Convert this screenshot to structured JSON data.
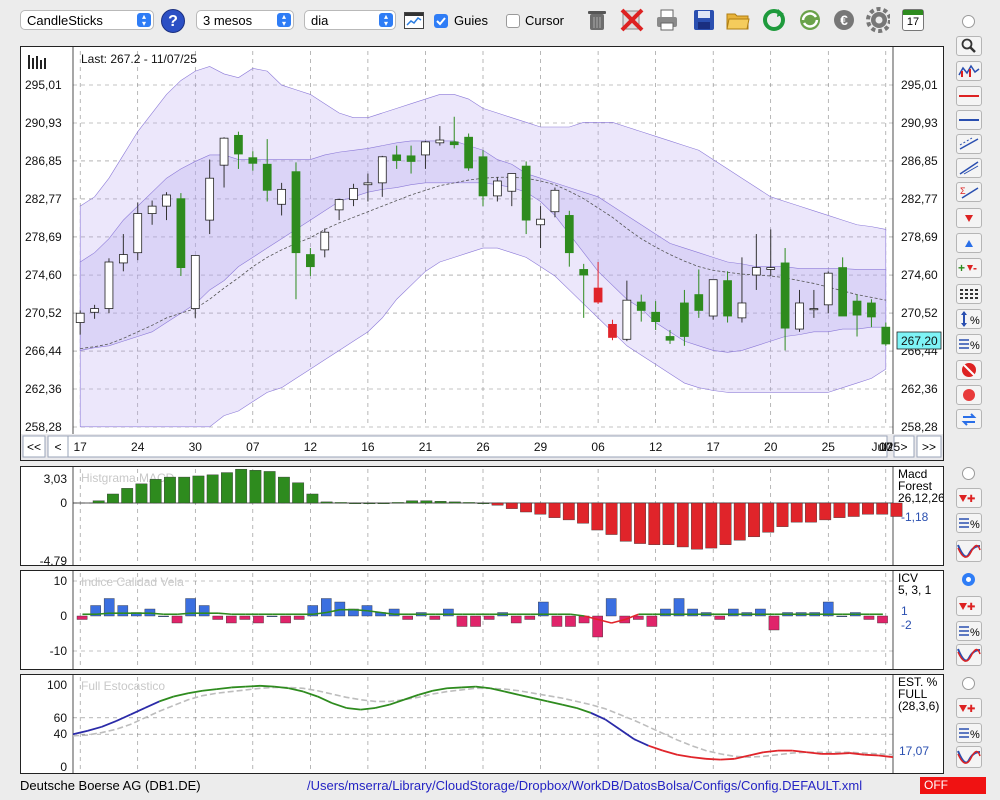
{
  "toolbar": {
    "chart_type": "CandleSticks",
    "period": "3 mesos",
    "interval": "dia",
    "guides_label": "Guies",
    "guides_checked": true,
    "cursor_label": "Cursor",
    "cursor_checked": false,
    "calendar_day": "17",
    "icons": [
      "help-icon",
      "chart-style-icon",
      "trash-icon",
      "delete-icon",
      "print-icon",
      "save-icon",
      "open-folder-icon",
      "refresh-icon",
      "sync-icon",
      "euro-icon",
      "settings-icon",
      "calendar-icon"
    ]
  },
  "main_chart": {
    "last_label": "Last: 267.2 - 11/07/25",
    "price_ticks": [
      "295,01",
      "290,93",
      "286,85",
      "282,77",
      "278,69",
      "274,60",
      "270,52",
      "266,44",
      "262,36",
      "258,28"
    ],
    "current_price_tag": "267,20",
    "nav": {
      "first": "<<",
      "prev": "<",
      "next": ">",
      "last": ">>"
    },
    "date_ticks": [
      "17",
      "24",
      "30",
      "07",
      "12",
      "16",
      "21",
      "26",
      "29",
      "06",
      "12",
      "17",
      "20",
      "25",
      "Jul25",
      "07",
      "10"
    ]
  },
  "macd": {
    "title": "Histgrama MACD",
    "ticks": [
      "3,03",
      "0",
      "-4,79"
    ],
    "legend": [
      "Macd",
      "Forest",
      "26,12,26"
    ],
    "value": "-1,18"
  },
  "icv": {
    "title": "Indice Calidad Vela",
    "ticks": [
      "10",
      "0",
      "-10"
    ],
    "legend": [
      "ICV",
      "5, 3, 1"
    ],
    "value1": "1",
    "value2": "-2"
  },
  "stochastic": {
    "title": "Full Estocastico",
    "ticks": [
      "100",
      "60",
      "40",
      "0"
    ],
    "legend": [
      "EST. %",
      "FULL",
      "(28,3,6)"
    ],
    "value": "17,07"
  },
  "status": {
    "ticker": "Deutsche Boerse AG (DB1.DE)",
    "path": "/Users/mserra/Library/CloudStorage/Dropbox/WorkDB/DatosBolsa/Configs/Config.DEFAULT.xml",
    "badge": "OFF"
  },
  "colors": {
    "up": "#2e8b1e",
    "down": "#e0242a",
    "band": "#b9aaf0",
    "macd_pos": "#2e8b1e",
    "macd_neg": "#e0242a",
    "icv_pos": "#3b6fe0",
    "icv_neg": "#e0246a",
    "accent": "#2f7df6"
  },
  "chart_data": [
    {
      "type": "candlestick",
      "ylim": [
        258.28,
        297.0
      ],
      "x": [
        "17",
        "",
        "",
        "",
        "24",
        "",
        "",
        "",
        "",
        "30",
        "",
        "",
        "",
        "07",
        "",
        "",
        "",
        "12",
        "",
        "",
        "",
        "16",
        "",
        "",
        "",
        "21",
        "",
        "",
        "",
        "26",
        "",
        "",
        "",
        "29",
        "",
        "",
        "",
        "",
        "06",
        "",
        "",
        "",
        "12",
        "",
        "",
        "",
        "17",
        "",
        "",
        "",
        "20",
        "",
        "",
        "",
        "25",
        "",
        "",
        "",
        "Jul25",
        "",
        "",
        "",
        "07",
        "",
        "",
        "",
        "10",
        ""
      ],
      "candles": [
        [
          269.5,
          270.8,
          268.2,
          270.5
        ],
        [
          270.6,
          271.4,
          269.9,
          271.0
        ],
        [
          271.0,
          276.4,
          270.5,
          276.0
        ],
        [
          275.9,
          279.0,
          275.0,
          276.8
        ],
        [
          277.0,
          282.4,
          276.2,
          281.2
        ],
        [
          281.2,
          282.6,
          280.0,
          282.0
        ],
        [
          282.0,
          283.5,
          280.5,
          283.2
        ],
        [
          282.8,
          283.4,
          274.5,
          275.4
        ],
        [
          271.0,
          276.7,
          270.0,
          276.7
        ],
        [
          280.5,
          287.0,
          279.0,
          285.0
        ],
        [
          286.4,
          289.4,
          284.0,
          289.3
        ],
        [
          289.6,
          290.0,
          286.0,
          287.6
        ],
        [
          287.2,
          287.9,
          285.8,
          286.6
        ],
        [
          286.5,
          289.2,
          282.5,
          283.7
        ],
        [
          282.2,
          284.5,
          281.0,
          283.8
        ],
        [
          285.7,
          286.7,
          272.0,
          277.0
        ],
        [
          276.8,
          277.5,
          274.5,
          275.5
        ],
        [
          277.3,
          279.6,
          276.5,
          279.2
        ],
        [
          281.6,
          282.8,
          280.5,
          282.7
        ],
        [
          282.7,
          284.4,
          282.0,
          283.9
        ],
        [
          284.3,
          285.5,
          282.5,
          284.5
        ],
        [
          284.5,
          287.4,
          283.0,
          287.3
        ],
        [
          287.5,
          288.5,
          286.0,
          286.9
        ],
        [
          287.4,
          288.5,
          285.5,
          286.8
        ],
        [
          287.5,
          289.0,
          286.0,
          288.9
        ],
        [
          288.8,
          290.6,
          288.5,
          289.1
        ],
        [
          288.9,
          291.6,
          288.2,
          288.6
        ],
        [
          289.4,
          289.8,
          285.8,
          286.1
        ],
        [
          287.3,
          288.0,
          282.0,
          283.1
        ],
        [
          283.1,
          285.1,
          282.5,
          284.7
        ],
        [
          283.6,
          285.5,
          282.0,
          285.5
        ],
        [
          286.3,
          286.8,
          279.0,
          280.5
        ],
        [
          280.0,
          282.0,
          277.5,
          280.6
        ],
        [
          281.4,
          284.0,
          280.8,
          283.7
        ],
        [
          281.0,
          281.5,
          275.5,
          277.0
        ],
        [
          275.2,
          275.8,
          270.0,
          274.6
        ],
        [
          273.2,
          276.0,
          271.5,
          271.7
        ],
        [
          269.3,
          269.8,
          267.6,
          267.9
        ],
        [
          267.7,
          274.0,
          267.5,
          271.9
        ],
        [
          271.7,
          272.5,
          269.6,
          270.8
        ],
        [
          270.6,
          271.8,
          268.7,
          269.6
        ],
        [
          268.0,
          268.7,
          267.2,
          267.6
        ],
        [
          271.6,
          273.0,
          267.0,
          268.0
        ],
        [
          272.5,
          275.2,
          270.0,
          270.8
        ],
        [
          270.2,
          274.0,
          269.8,
          274.1
        ],
        [
          274.0,
          275.0,
          269.5,
          270.2
        ],
        [
          270.0,
          276.5,
          269.5,
          271.6
        ],
        [
          274.6,
          279.0,
          273.0,
          275.4
        ],
        [
          275.2,
          279.5,
          274.5,
          275.4
        ],
        [
          275.9,
          277.5,
          266.5,
          268.9
        ],
        [
          268.8,
          273.0,
          268.5,
          271.6
        ],
        [
          270.9,
          273.0,
          270.0,
          271.0
        ],
        [
          271.4,
          275.0,
          270.5,
          274.8
        ],
        [
          275.4,
          276.5,
          270.2,
          270.2
        ],
        [
          271.8,
          272.5,
          268.0,
          270.3
        ],
        [
          271.6,
          272.0,
          269.0,
          270.1
        ],
        [
          269.0,
          269.5,
          267.0,
          267.2
        ]
      ],
      "sma": [
        266.7,
        266.9,
        267.2,
        267.8,
        268.5,
        269.2,
        270.0,
        270.5,
        271.0,
        272.0,
        273.2,
        274.3,
        275.5,
        276.5,
        277.3,
        278.0,
        278.6,
        279.5,
        280.2,
        280.8,
        281.4,
        282.0,
        282.6,
        283.2,
        283.7,
        284.2,
        284.5,
        284.8,
        285.0,
        285.1,
        285.1,
        285.0,
        284.7,
        284.3,
        283.6,
        282.8,
        281.8,
        280.8,
        279.6,
        278.5,
        277.6,
        276.8,
        276.1,
        275.5,
        275.1,
        274.9,
        274.7,
        274.6,
        274.5,
        274.3,
        274.0,
        273.7,
        273.3,
        272.9,
        272.5,
        272.2,
        271.9
      ],
      "band_outer_upper": [
        282.0,
        283.0,
        285.0,
        287.5,
        290.0,
        292.0,
        294.0,
        295.5,
        296.5,
        297.0,
        296.2,
        295.8,
        296.8,
        296.5,
        295.0,
        294.5,
        294.0,
        293.0,
        292.0,
        291.5,
        291.5,
        292.0,
        292.5,
        293.0,
        293.5,
        294.0,
        294.0,
        293.5,
        292.5,
        292.0,
        291.5,
        291.0,
        290.5,
        290.5,
        290.5,
        291.0,
        291.0,
        291.0,
        290.5,
        290.0,
        289.5,
        289.0,
        288.5,
        288.0,
        287.0,
        286.0,
        285.0,
        284.0,
        283.0,
        282.5,
        282.0,
        281.5,
        281.0,
        280.5,
        280.0,
        279.8,
        279.5
      ],
      "band_inner_upper": [
        276.0,
        277.0,
        278.5,
        280.5,
        282.0,
        283.5,
        285.0,
        286.0,
        286.8,
        287.5,
        287.5,
        287.0,
        287.0,
        287.0,
        287.0,
        287.0,
        287.0,
        287.5,
        287.8,
        288.0,
        288.2,
        288.5,
        288.8,
        289.0,
        289.0,
        289.0,
        289.0,
        288.5,
        288.0,
        287.0,
        286.5,
        285.5,
        285.0,
        284.5,
        284.0,
        283.5,
        283.0,
        282.0,
        281.0,
        280.0,
        279.0,
        278.0,
        277.5,
        277.0,
        276.5,
        276.0,
        275.8,
        275.5,
        275.5,
        275.5,
        275.3,
        275.3,
        275.3,
        275.3,
        275.2,
        275.2,
        275.2
      ],
      "band_inner_lower": [
        266.5,
        266.8,
        267.0,
        267.5,
        268.0,
        268.5,
        269.5,
        270.5,
        271.5,
        273.0,
        274.0,
        275.5,
        276.5,
        277.5,
        278.5,
        279.5,
        280.5,
        281.5,
        282.5,
        283.0,
        283.5,
        283.8,
        284.0,
        284.3,
        284.5,
        284.5,
        284.5,
        284.5,
        284.5,
        284.3,
        284.0,
        283.5,
        282.5,
        281.0,
        279.0,
        277.0,
        275.0,
        273.5,
        272.0,
        271.0,
        269.5,
        268.5,
        267.5,
        267.0,
        266.5,
        266.3,
        266.5,
        267.0,
        267.5,
        268.0,
        268.2,
        268.5,
        268.5,
        268.8,
        268.8,
        269.0,
        269.0
      ],
      "band_outer_lower": [
        258.3,
        258.3,
        258.3,
        258.3,
        258.3,
        258.3,
        258.3,
        258.3,
        258.3,
        258.3,
        259.5,
        260.0,
        261.0,
        262.0,
        262.5,
        263.5,
        264.5,
        265.5,
        266.5,
        267.5,
        268.5,
        270.0,
        272.0,
        273.5,
        275.0,
        276.0,
        276.5,
        277.0,
        277.5,
        277.5,
        277.0,
        276.5,
        275.5,
        274.5,
        273.0,
        271.5,
        270.0,
        268.5,
        267.0,
        266.0,
        265.0,
        264.0,
        263.0,
        262.5,
        262.2,
        262.0,
        262.0,
        262.0,
        262.0,
        262.0,
        262.0,
        262.0,
        262.0,
        262.5,
        263.0,
        263.5,
        264.5
      ]
    },
    {
      "type": "bar",
      "title": "Histgrama MACD",
      "ylim": [
        -4.79,
        3.03
      ],
      "values": [
        0.2,
        0.8,
        1.3,
        1.7,
        2.1,
        2.3,
        2.3,
        2.4,
        2.5,
        2.7,
        3.0,
        2.9,
        2.8,
        2.3,
        1.8,
        0.8,
        0.1,
        0.05,
        0,
        0,
        0,
        0.05,
        0.2,
        0.2,
        0.15,
        0.1,
        0.05,
        0,
        -0.2,
        -0.5,
        -0.8,
        -1.0,
        -1.3,
        -1.5,
        -1.8,
        -2.4,
        -2.8,
        -3.4,
        -3.6,
        -3.7,
        -3.7,
        -3.9,
        -4.1,
        -4.0,
        -3.7,
        -3.3,
        -3.0,
        -2.6,
        -2.1,
        -1.7,
        -1.7,
        -1.5,
        -1.3,
        -1.2,
        -1.0,
        -1.0,
        -1.2
      ]
    },
    {
      "type": "bar",
      "title": "Indice Calidad Vela",
      "ylim": [
        -10,
        10
      ],
      "values": [
        -1,
        3,
        5,
        3,
        1,
        2,
        0,
        -2,
        5,
        3,
        -1,
        -2,
        -1,
        -2,
        0,
        -2,
        -1,
        3,
        5,
        4,
        2,
        3,
        1,
        2,
        -1,
        1,
        -1,
        2,
        -3,
        -3,
        -1,
        1,
        -2,
        -1,
        4,
        -3,
        -3,
        -2,
        -6,
        5,
        -2,
        -1,
        -3,
        2,
        5,
        2,
        1,
        -1,
        2,
        1,
        2,
        -4,
        1,
        1,
        1,
        4,
        0,
        1,
        -1,
        -2
      ],
      "signal": [
        0.5,
        0.5,
        0.8,
        0.8,
        0.8,
        0.8,
        0.5,
        0.5,
        0.8,
        0.8,
        0.8,
        0.5,
        0.5,
        0.5,
        0.5,
        0.5,
        0.5,
        0.5,
        1.0,
        1.8,
        1.8,
        1.5,
        1.0,
        0.5,
        0.5,
        0.5,
        0.5,
        0.5,
        0.5,
        0.5,
        0.5,
        0.5,
        0.5,
        0.5,
        0.5,
        0.5,
        0.5,
        0,
        -1.0,
        -2.0,
        -1.0,
        0.5,
        0.5,
        0.5,
        0.5,
        0.5,
        0.5,
        0.5,
        0.5,
        0.5,
        0.5,
        0.5,
        0.5,
        0.5,
        0.5,
        0.5,
        0.5,
        0.5,
        0.5,
        0.5
      ]
    },
    {
      "type": "line",
      "title": "Full Estocastico",
      "ylim": [
        0,
        110
      ],
      "series": [
        {
          "values": [
            40,
            44,
            49,
            56,
            64,
            72,
            80,
            86,
            90,
            93,
            95,
            97,
            98,
            99,
            98,
            96,
            92,
            86,
            78,
            72,
            70,
            72,
            76,
            82,
            88,
            93,
            96,
            97,
            98,
            96,
            92,
            88,
            84,
            80,
            76,
            72,
            66,
            58,
            46,
            34,
            26,
            20,
            15,
            12,
            10,
            9,
            10,
            14,
            18,
            20,
            20,
            18,
            16,
            16,
            17,
            15,
            14,
            12
          ]
        },
        {
          "values": [
            38,
            39,
            42,
            46,
            52,
            60,
            68,
            75,
            82,
            87,
            90,
            92,
            94,
            96,
            97,
            97,
            96,
            93,
            89,
            85,
            82,
            80,
            80,
            82,
            85,
            89,
            92,
            94,
            96,
            96,
            95,
            93,
            90,
            87,
            84,
            80,
            76,
            71,
            64,
            57,
            49,
            41,
            33,
            26,
            20,
            16,
            13,
            12,
            13,
            15,
            17,
            18,
            18,
            18,
            18,
            17,
            16,
            15
          ]
        }
      ]
    }
  ]
}
